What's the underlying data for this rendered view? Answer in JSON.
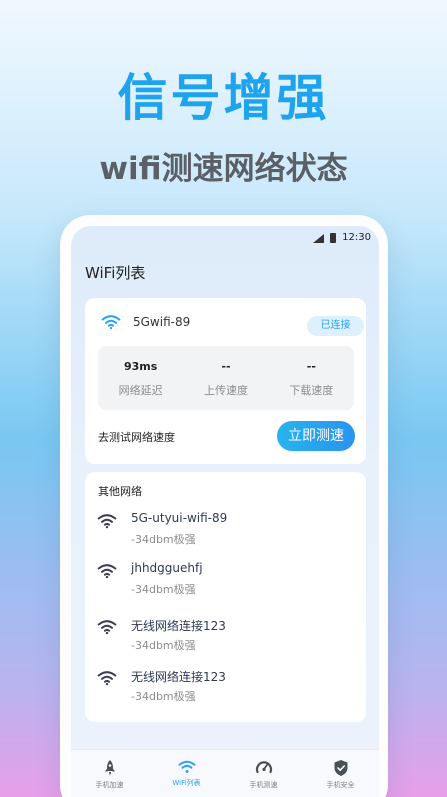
{
  "promo": {
    "headline": "信号增强",
    "subline": "wifi测速网络状态"
  },
  "status_bar": {
    "time": "12:30"
  },
  "page_title": "WiFi列表",
  "connected": {
    "ssid": "5Gwifi-89",
    "status_badge": "已连接",
    "stats": [
      {
        "value": "93ms",
        "label": "网络延迟"
      },
      {
        "value": "--",
        "label": "上传速度"
      },
      {
        "value": "--",
        "label": "下载速度"
      }
    ],
    "test_label": "去测试网络速度",
    "test_button": "立即测速"
  },
  "other_networks": {
    "title": "其他网络",
    "items": [
      {
        "ssid": "5G-utyui-wifi-89",
        "signal": "-34dbm极强"
      },
      {
        "ssid": "jhhdgguehfj",
        "signal": "-34dbm极强"
      },
      {
        "ssid": "无线网络连接123",
        "signal": "-34dbm极强"
      },
      {
        "ssid": "无线网络连接123",
        "signal": "-34dbm极强"
      }
    ]
  },
  "tabbar": {
    "items": [
      {
        "label": "手机加速",
        "icon": "rocket-icon"
      },
      {
        "label": "WiFi列表",
        "icon": "wifi-icon"
      },
      {
        "label": "手机测速",
        "icon": "speedometer-icon"
      },
      {
        "label": "手机安全",
        "icon": "shield-check-icon"
      }
    ],
    "active": "WiFi列表"
  },
  "colors": {
    "accent": "#29a3ee",
    "headline": "#1ea3ee",
    "badge_bg": "#def0fc"
  }
}
